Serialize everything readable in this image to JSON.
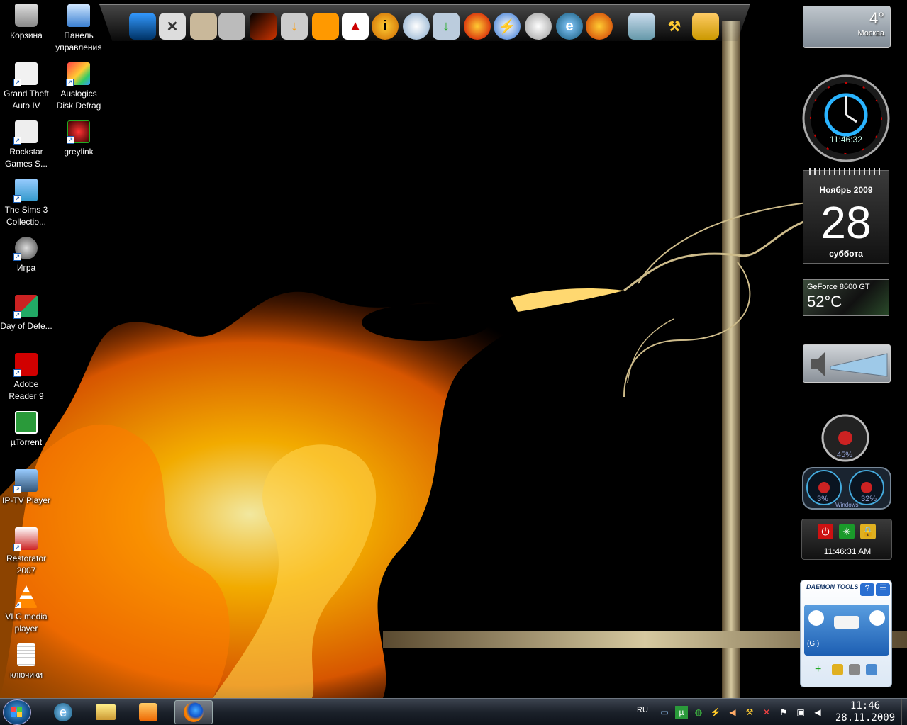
{
  "desktop": {
    "icons": [
      {
        "label": "Корзина",
        "icon": "recycle-bin-icon"
      },
      {
        "label": "Панель управления",
        "icon": "control-panel-icon"
      },
      {
        "label": "Grand Theft Auto IV",
        "icon": "gta-iv-icon"
      },
      {
        "label": "Auslogics Disk Defrag",
        "icon": "disk-defrag-icon"
      },
      {
        "label": "Rockstar Games S...",
        "icon": "rockstar-icon"
      },
      {
        "label": "greylink",
        "icon": "greylink-icon"
      },
      {
        "label": "The Sims 3 Collectio...",
        "icon": "sims3-icon"
      },
      {
        "label": "Игра",
        "icon": "game-icon"
      },
      {
        "label": "Day of Defe...",
        "icon": "day-of-defeat-icon"
      },
      {
        "label": "Adobe Reader 9",
        "icon": "adobe-reader-icon"
      },
      {
        "label": "µTorrent",
        "icon": "utorrent-icon"
      },
      {
        "label": "IP-TV Player",
        "icon": "iptv-player-icon"
      },
      {
        "label": "Restorator 2007",
        "icon": "restorator-icon"
      },
      {
        "label": "VLC media player",
        "icon": "vlc-icon"
      },
      {
        "label": "ключики",
        "icon": "text-file-icon"
      }
    ]
  },
  "dock": {
    "items": [
      "monitor-icon",
      "tools-icon",
      "photo-icon",
      "film-icon",
      "fire-image-icon",
      "download-icon",
      "media-player-icon",
      "chart-icon",
      "info-icon",
      "disc-burn-icon",
      "install-icon",
      "nero-icon",
      "daemon-tools-icon",
      "dvd-icon",
      "ie-icon",
      "firefox-icon",
      "recycle-bin-icon",
      "tools-wrench-icon",
      "trash-icon"
    ]
  },
  "gadgets": {
    "weather": {
      "temp": "4°",
      "city": "Москва"
    },
    "clock": {
      "time": "11:46:32"
    },
    "calendar": {
      "month": "Ноябрь 2009",
      "day": "28",
      "weekday": "суббота"
    },
    "gpu": {
      "name": "GeForce 8600 GT",
      "temp": "52°C"
    },
    "cpu": {
      "main": "45%",
      "core1": "3%",
      "core2": "32%",
      "brand": "Windows"
    },
    "shutdown": {
      "time": "11:46:31 AM"
    },
    "daemon": {
      "title": "DAEMON TOOLS",
      "drive": "(G:)"
    }
  },
  "taskbar": {
    "start_label": "Start",
    "pinned": [
      "ie-icon",
      "explorer-icon",
      "media-player-icon",
      "firefox-icon"
    ],
    "language": "RU",
    "time": "11:46",
    "date": "28.11.2009"
  },
  "colors": {
    "flame": "#ff8a00",
    "taskbar": "#1c222b",
    "accent": "#1c5fb5"
  }
}
